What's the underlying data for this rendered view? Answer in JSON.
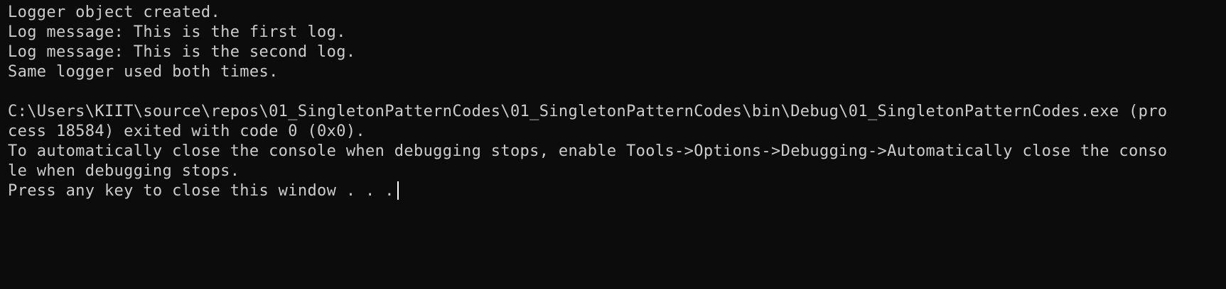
{
  "colors": {
    "background": "#0c0c0c",
    "text": "#cccccc",
    "cursor": "#ffffff"
  },
  "console": {
    "lines": [
      "Logger object created.",
      "Log message: This is the first log.",
      "Log message: This is the second log.",
      "Same logger used both times.",
      "",
      "C:\\Users\\KIIT\\source\\repos\\01_SingletonPatternCodes\\01_SingletonPatternCodes\\bin\\Debug\\01_SingletonPatternCodes.exe (pro",
      "cess 18584) exited with code 0 (0x0).",
      "To automatically close the console when debugging stops, enable Tools->Options->Debugging->Automatically close the conso",
      "le when debugging stops.",
      "Press any key to close this window . . ."
    ]
  }
}
